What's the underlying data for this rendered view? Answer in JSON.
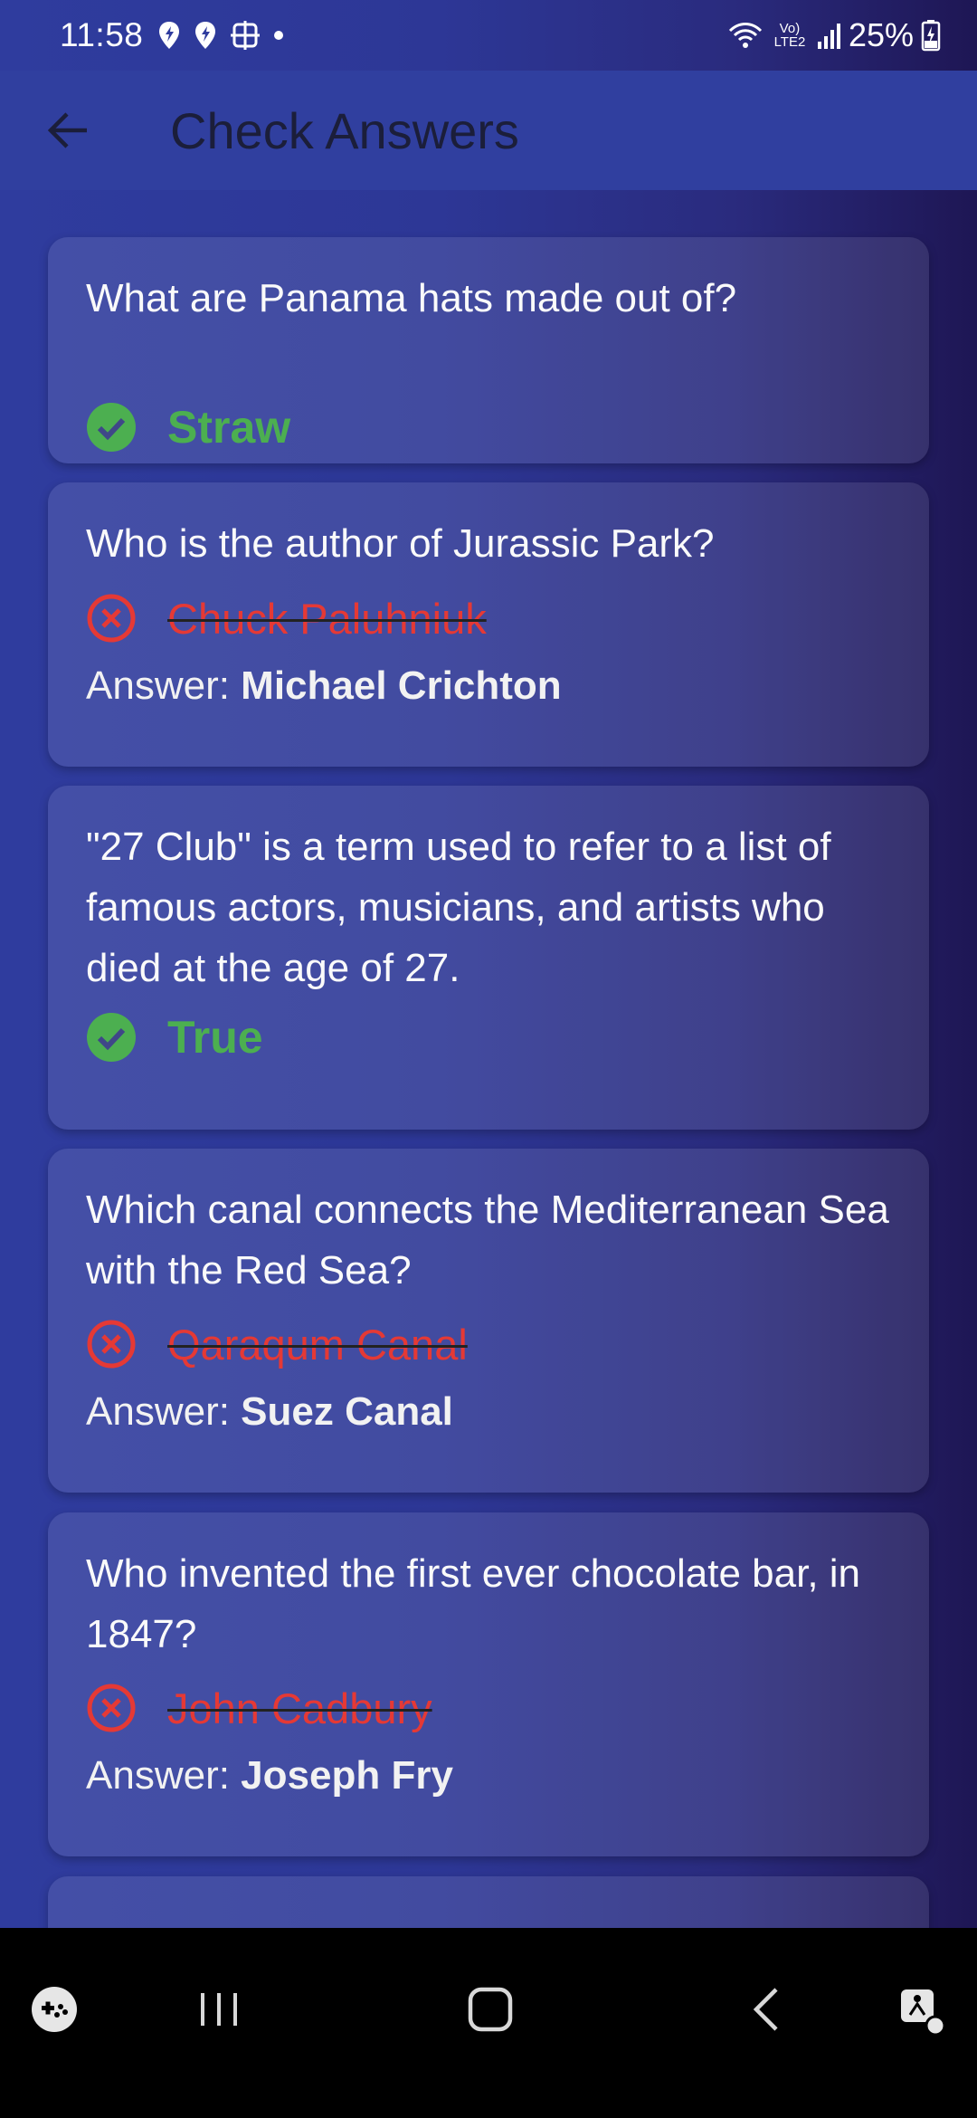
{
  "status_bar": {
    "time": "11:58",
    "battery": "25%",
    "network": "Vo) LTE2"
  },
  "app_bar": {
    "title": "Check Answers"
  },
  "answer_prefix": "Answer: ",
  "colors": {
    "correct": "#4caf50",
    "wrong": "#e53935",
    "app_bar": "#303f9f"
  },
  "questions": [
    {
      "question": "What are Panama hats made out of?",
      "selected": "Straw",
      "is_correct": true
    },
    {
      "question": "Who is the author of Jurassic Park?",
      "selected": "Chuck Paluhniuk",
      "is_correct": false,
      "correct_answer": "Michael Crichton"
    },
    {
      "question": "\"27 Club\" is a term used to refer to a list of famous actors, musicians, and artists who died at the age of 27.",
      "selected": "True",
      "is_correct": true
    },
    {
      "question": "Which canal connects the Mediterranean Sea with the Red Sea?",
      "selected": "Qaraqum Canal",
      "is_correct": false,
      "correct_answer": "Suez Canal"
    },
    {
      "question": "Who invented the first ever chocolate bar, in 1847?",
      "selected": "John Cadbury",
      "is_correct": false,
      "correct_answer": "Joseph Fry"
    }
  ],
  "icons": {
    "correct": "check-circle-icon",
    "wrong": "x-circle-icon",
    "back": "arrow-left-icon",
    "nav": [
      "game-launcher-icon",
      "recent-apps-icon",
      "home-icon",
      "back-icon",
      "accessibility-icon"
    ]
  }
}
